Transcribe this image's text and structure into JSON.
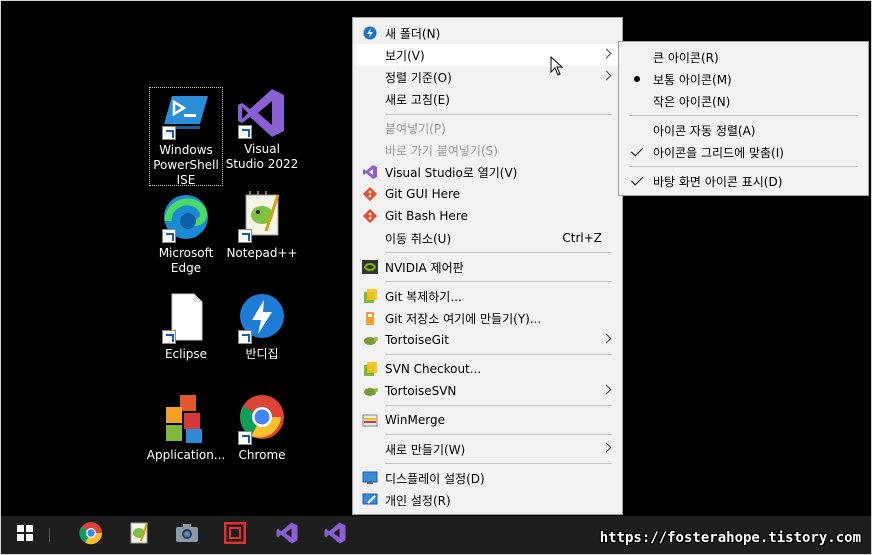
{
  "desktop": {
    "icons": [
      {
        "label": "Windows PowerShell ISE",
        "icon": "powershell-ise-icon"
      },
      {
        "label": "Visual Studio 2022",
        "icon": "visual-studio-icon"
      },
      {
        "label": "Microsoft Edge",
        "icon": "edge-icon"
      },
      {
        "label": "Notepad++",
        "icon": "notepad-plus-plus-icon"
      },
      {
        "label": "Eclipse",
        "icon": "eclipse-file-icon"
      },
      {
        "label": "반디집",
        "icon": "bandizip-icon"
      },
      {
        "label": "Application...",
        "icon": "application-blocks-icon"
      },
      {
        "label": "Chrome",
        "icon": "chrome-icon"
      }
    ]
  },
  "context_menu": {
    "items": [
      {
        "label": "새 폴더(N)",
        "icon": "new-folder-icon"
      },
      {
        "label": "보기(V)",
        "submenu": true
      },
      {
        "label": "정렬 기준(O)",
        "submenu": true
      },
      {
        "label": "새로 고침(E)"
      },
      {
        "label": "붙여넣기(P)",
        "disabled": true
      },
      {
        "label": "바로 가기 붙여넣기(S)",
        "disabled": true
      },
      {
        "label": "Visual Studio로 열기(V)",
        "icon": "visual-studio-icon"
      },
      {
        "label": "Git GUI Here",
        "icon": "git-gui-icon"
      },
      {
        "label": "Git Bash Here",
        "icon": "git-bash-icon"
      },
      {
        "label": "이동 취소(U)",
        "shortcut": "Ctrl+Z"
      },
      {
        "label": "NVIDIA 제어판",
        "icon": "nvidia-icon"
      },
      {
        "label": "Git 복제하기...",
        "icon": "tortoisegit-clone-icon"
      },
      {
        "label": "Git 저장소 여기에 만들기(Y)...",
        "icon": "tortoisegit-create-repo-icon"
      },
      {
        "label": "TortoiseGit",
        "icon": "tortoisegit-icon",
        "submenu": true
      },
      {
        "label": "SVN Checkout...",
        "icon": "svn-checkout-icon"
      },
      {
        "label": "TortoiseSVN",
        "icon": "tortoisesvn-icon",
        "submenu": true
      },
      {
        "label": "WinMerge",
        "icon": "winmerge-icon"
      },
      {
        "label": "새로 만들기(W)",
        "submenu": true
      },
      {
        "label": "디스플레이 설정(D)",
        "icon": "display-settings-icon"
      },
      {
        "label": "개인 설정(R)",
        "icon": "personalize-icon"
      }
    ]
  },
  "view_submenu": {
    "items": [
      {
        "label": "큰 아이콘(R)",
        "mark": ""
      },
      {
        "label": "보통 아이콘(M)",
        "mark": "bullet"
      },
      {
        "label": "작은 아이콘(N)",
        "mark": ""
      },
      {
        "label": "아이콘 자동 정렬(A)",
        "mark": ""
      },
      {
        "label": "아이콘을 그리드에 맞춤(I)",
        "mark": "check"
      },
      {
        "label": "바탕 화면 아이콘 표시(D)",
        "mark": "check"
      }
    ]
  },
  "taskbar": {
    "items": [
      "windows-start-icon",
      "chrome-icon",
      "notepad-plus-plus-icon",
      "camera-icon",
      "bandicam-icon",
      "visual-studio-icon",
      "visual-studio-icon"
    ]
  },
  "watermark": "https://fosterahope.tistory.com",
  "colors": {
    "desktop_bg": "#000000",
    "menu_bg": "#f2f2f2",
    "menu_hover": "#ffffff",
    "disabled_text": "#9a9a9a",
    "vs_purple": "#7b4fc9",
    "taskbar_bg": "#1e1e1e"
  }
}
